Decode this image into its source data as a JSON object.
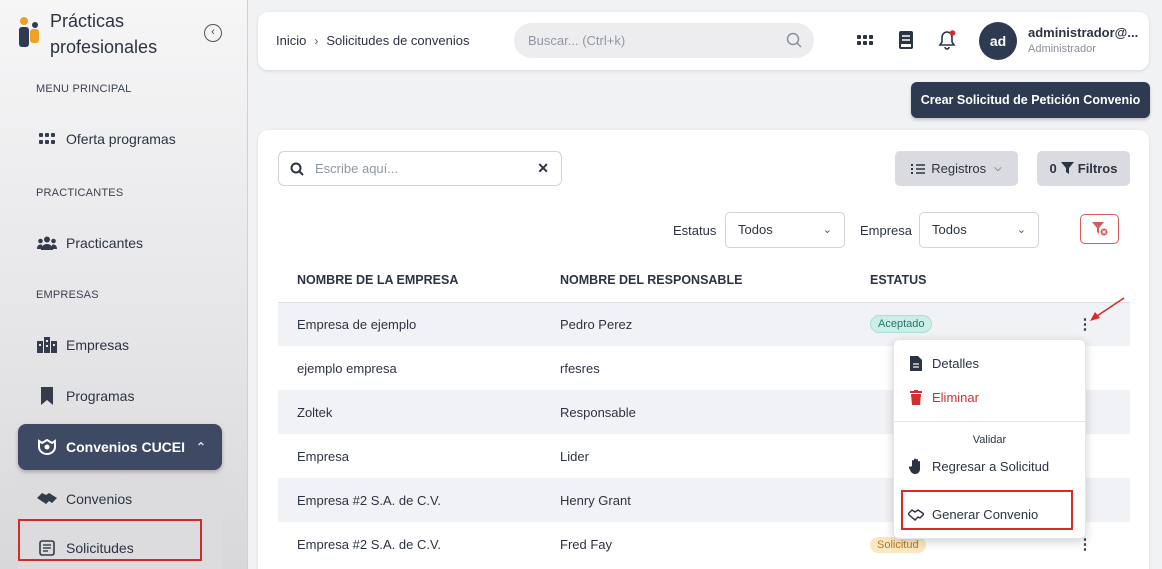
{
  "sidebar": {
    "brand_title": "Prácticas profesionales",
    "sections": {
      "main": "MENU PRINCIPAL",
      "practicantes": "PRACTICANTES",
      "empresas": "EMPRESAS"
    },
    "items": [
      {
        "label": "Oferta programas",
        "icon": "grid-icon"
      },
      {
        "label": "Practicantes",
        "icon": "people-icon"
      },
      {
        "label": "Empresas",
        "icon": "buildings-icon"
      },
      {
        "label": "Programas",
        "icon": "bookmark-icon"
      },
      {
        "label": "Convenios CUCEI",
        "icon": "handshake-icon"
      },
      {
        "label": "Convenios",
        "icon": "handshake-icon"
      },
      {
        "label": "Solicitudes",
        "icon": "form-icon"
      }
    ]
  },
  "topbar": {
    "breadcrumb": [
      "Inicio",
      "Solicitudes de convenios"
    ],
    "search_placeholder": "Buscar... (Ctrl+k)",
    "user": {
      "initials": "ad",
      "name": "administrador@...",
      "role": "Administrador"
    }
  },
  "actions": {
    "create_label": "Crear Solicitud de Petición Convenio"
  },
  "table_tools": {
    "search_placeholder": "Escribe aquí...",
    "records_label": "Registros",
    "filters_count": "0",
    "filters_label": "Filtros",
    "status_label": "Estatus",
    "status_value": "Todos",
    "company_label": "Empresa",
    "company_value": "Todos"
  },
  "table": {
    "headers": [
      "NOMBRE DE LA EMPRESA",
      "NOMBRE DEL RESPONSABLE",
      "ESTATUS"
    ],
    "rows": [
      {
        "company": "Empresa de ejemplo",
        "responsible": "Pedro Perez",
        "status": "Aceptado"
      },
      {
        "company": "ejemplo empresa",
        "responsible": "rfesres",
        "status": ""
      },
      {
        "company": "Zoltek",
        "responsible": "Responsable",
        "status": ""
      },
      {
        "company": "Empresa",
        "responsible": "Lider",
        "status": ""
      },
      {
        "company": "Empresa #2 S.A. de C.V.",
        "responsible": "Henry Grant",
        "status": ""
      },
      {
        "company": "Empresa #2 S.A. de C.V.",
        "responsible": "Fred Fay",
        "status": "Solicitud"
      }
    ]
  },
  "menu": {
    "details": "Detalles",
    "delete": "Eliminar",
    "group": "Validar",
    "return": "Regresar a Solicitud",
    "generate": "Generar Convenio"
  },
  "colors": {
    "primary": "#2e3a52",
    "danger": "#d32f2f",
    "highlight": "#d62b2b"
  }
}
